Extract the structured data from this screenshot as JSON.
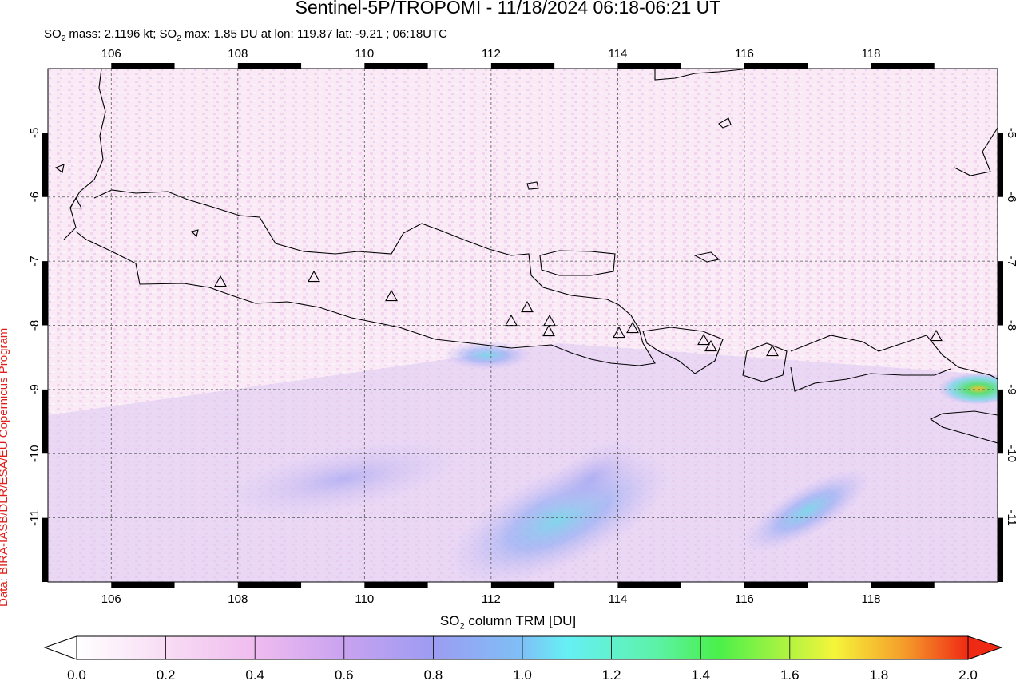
{
  "header": {
    "title": "Sentinel-5P/TROPOMI - 11/18/2024 06:18-06:21 UT",
    "stats_prefix": "SO",
    "stats_mass_label": "mass: 2.1196 kt; SO",
    "stats_max_text": "max: 1.85 DU at lon: 119.87 lat: -9.21 ; 06:18UTC",
    "sub": "2"
  },
  "credit": "Data: BIRA-IASB/DLR/ESA/EU Copernicus Program",
  "map": {
    "lon_ticks": [
      "106",
      "108",
      "110",
      "112",
      "114",
      "116",
      "118"
    ],
    "lat_ticks": [
      "-5",
      "-6",
      "-7",
      "-8",
      "-9",
      "-10",
      "-11"
    ],
    "lon_range": [
      105,
      120
    ],
    "lat_range": [
      -12,
      -4
    ],
    "volcano_count": 17
  },
  "colorbar": {
    "label_pre": "SO",
    "label_sub": "2",
    "label_post": " column TRM [DU]",
    "ticks": [
      "0.0",
      "0.2",
      "0.4",
      "0.6",
      "0.8",
      "1.0",
      "1.2",
      "1.4",
      "1.6",
      "1.8",
      "2.0"
    ],
    "colors": [
      "#ffffff",
      "#f8d8f2",
      "#e8b0f0",
      "#b59bf0",
      "#8aa8f5",
      "#66f0f5",
      "#55f077",
      "#4af04a",
      "#f5f53a",
      "#f59a2a",
      "#ef2a14"
    ]
  }
}
